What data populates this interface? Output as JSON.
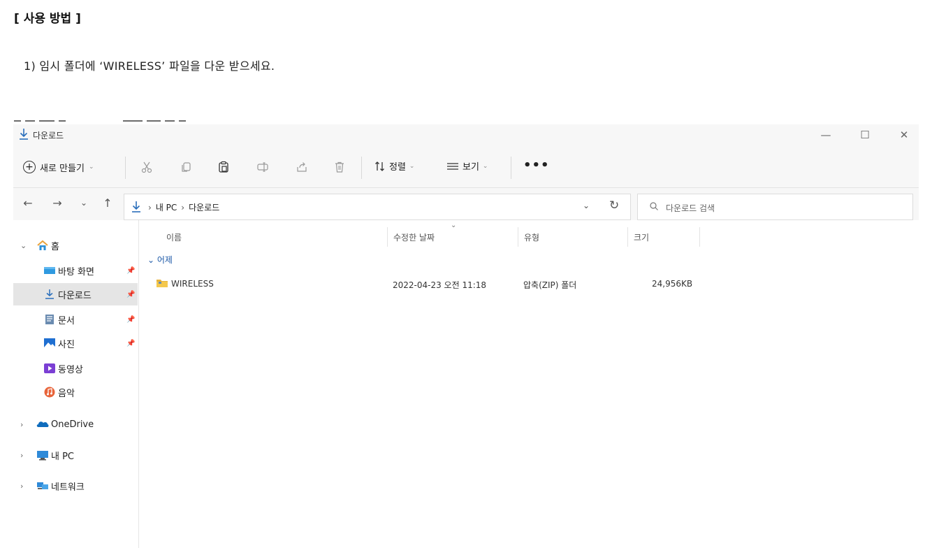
{
  "doc": {
    "heading": "[ 사용 방법 ]",
    "step1": "1) 임시 폴더에 ‘WIRELESS’ 파일을 다운 받으세요."
  },
  "window": {
    "title": "다운로드",
    "controls": {
      "minimize": "—",
      "maximize": "☐",
      "close": "✕"
    }
  },
  "toolbar": {
    "new_label": "새로 만들기",
    "sort_label": "정렬",
    "view_label": "보기",
    "more_label": "•••"
  },
  "address": {
    "segments": [
      "내 PC",
      "다운로드"
    ],
    "separator": "›"
  },
  "search": {
    "placeholder": "다운로드 검색"
  },
  "sidebar": {
    "items": [
      {
        "label": "홈",
        "icon": "home-icon"
      },
      {
        "label": "바탕 화면",
        "icon": "desktop-icon",
        "pinned": true
      },
      {
        "label": "다운로드",
        "icon": "download-icon",
        "pinned": true,
        "selected": true
      },
      {
        "label": "문서",
        "icon": "document-icon",
        "pinned": true
      },
      {
        "label": "사진",
        "icon": "pictures-icon",
        "pinned": true
      },
      {
        "label": "동영상",
        "icon": "videos-icon"
      },
      {
        "label": "음악",
        "icon": "music-icon"
      },
      {
        "label": "OneDrive",
        "icon": "onedrive-icon"
      },
      {
        "label": "내 PC",
        "icon": "pc-icon"
      },
      {
        "label": "네트워크",
        "icon": "network-icon"
      }
    ]
  },
  "list": {
    "columns": [
      "이름",
      "수정한 날짜",
      "유형",
      "크기"
    ],
    "group": "어제",
    "rows": [
      {
        "name": "WIRELESS",
        "modified": "2022-04-23 오전 11:18",
        "type": "압축(ZIP) 폴더",
        "size": "24,956KB"
      }
    ]
  },
  "colors": {
    "accent": "#2a6ebb",
    "folder": "#e8b339",
    "selected_bg": "#e5e5e5"
  }
}
